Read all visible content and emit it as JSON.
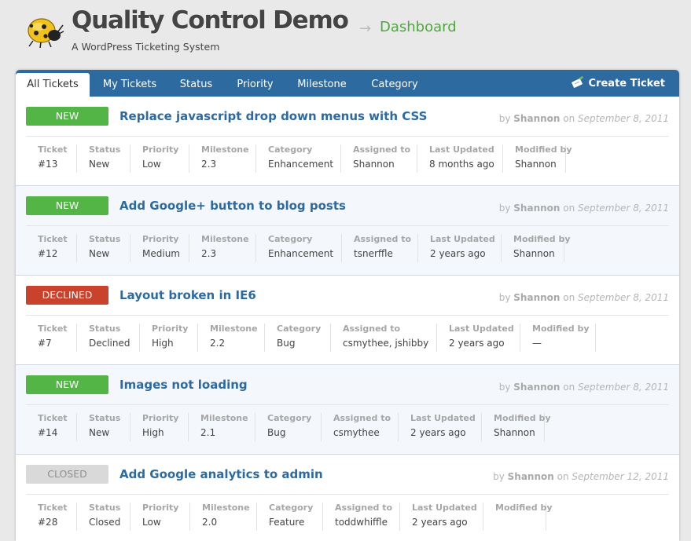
{
  "header": {
    "title": "Quality Control Demo",
    "arrow": "→",
    "crumb": "Dashboard",
    "tagline": "A WordPress Ticketing System",
    "logo_icon": "ladybug-icon"
  },
  "nav": {
    "tabs": [
      {
        "label": "All Tickets",
        "active": true
      },
      {
        "label": "My Tickets"
      },
      {
        "label": "Status"
      },
      {
        "label": "Priority"
      },
      {
        "label": "Milestone"
      },
      {
        "label": "Category"
      }
    ],
    "create_label": "Create Ticket",
    "create_icon": "ticket-pen-icon"
  },
  "labels": {
    "ticket": "Ticket",
    "status": "Status",
    "priority": "Priority",
    "milestone": "Milestone",
    "category": "Category",
    "assigned": "Assigned to",
    "updated": "Last Updated",
    "modified": "Modified by",
    "by": "by",
    "on": "on"
  },
  "tickets": [
    {
      "badge": "NEW",
      "title": "Replace javascript drop down menus with CSS",
      "author": "Shannon",
      "date": "September 8, 2011",
      "number": "#13",
      "status": "New",
      "priority": "Low",
      "milestone": "2.3",
      "category": "Enhancement",
      "assigned": "Shannon",
      "updated": "8 months ago",
      "modified": "Shannon"
    },
    {
      "badge": "NEW",
      "title": "Add Google+ button to blog posts",
      "author": "Shannon",
      "date": "September 8, 2011",
      "number": "#12",
      "status": "New",
      "priority": "Medium",
      "milestone": "2.3",
      "category": "Enhancement",
      "assigned": "tsnerffle",
      "updated": "2 years ago",
      "modified": "Shannon"
    },
    {
      "badge": "DECLINED",
      "title": "Layout broken in IE6",
      "author": "Shannon",
      "date": "September 8, 2011",
      "number": "#7",
      "status": "Declined",
      "priority": "High",
      "milestone": "2.2",
      "category": "Bug",
      "assigned": "csmythee, jshibby",
      "updated": "2 years ago",
      "modified": "—"
    },
    {
      "badge": "NEW",
      "title": "Images not loading",
      "author": "Shannon",
      "date": "September 8, 2011",
      "number": "#14",
      "status": "New",
      "priority": "High",
      "milestone": "2.1",
      "category": "Bug",
      "assigned": "csmythee",
      "updated": "2 years ago",
      "modified": "Shannon"
    },
    {
      "badge": "CLOSED",
      "title": "Add Google analytics to admin",
      "author": "Shannon",
      "date": "September 12, 2011",
      "number": "#28",
      "status": "Closed",
      "priority": "Low",
      "milestone": "2.0",
      "category": "Feature",
      "assigned": "toddwhiffle",
      "updated": "2 years ago",
      "modified": ""
    }
  ],
  "colors": {
    "accent": "#2d6aa0",
    "new": "#54b547",
    "declined": "#c9422c",
    "closed": "#d9d9d9",
    "crumb": "#4fa83d"
  }
}
